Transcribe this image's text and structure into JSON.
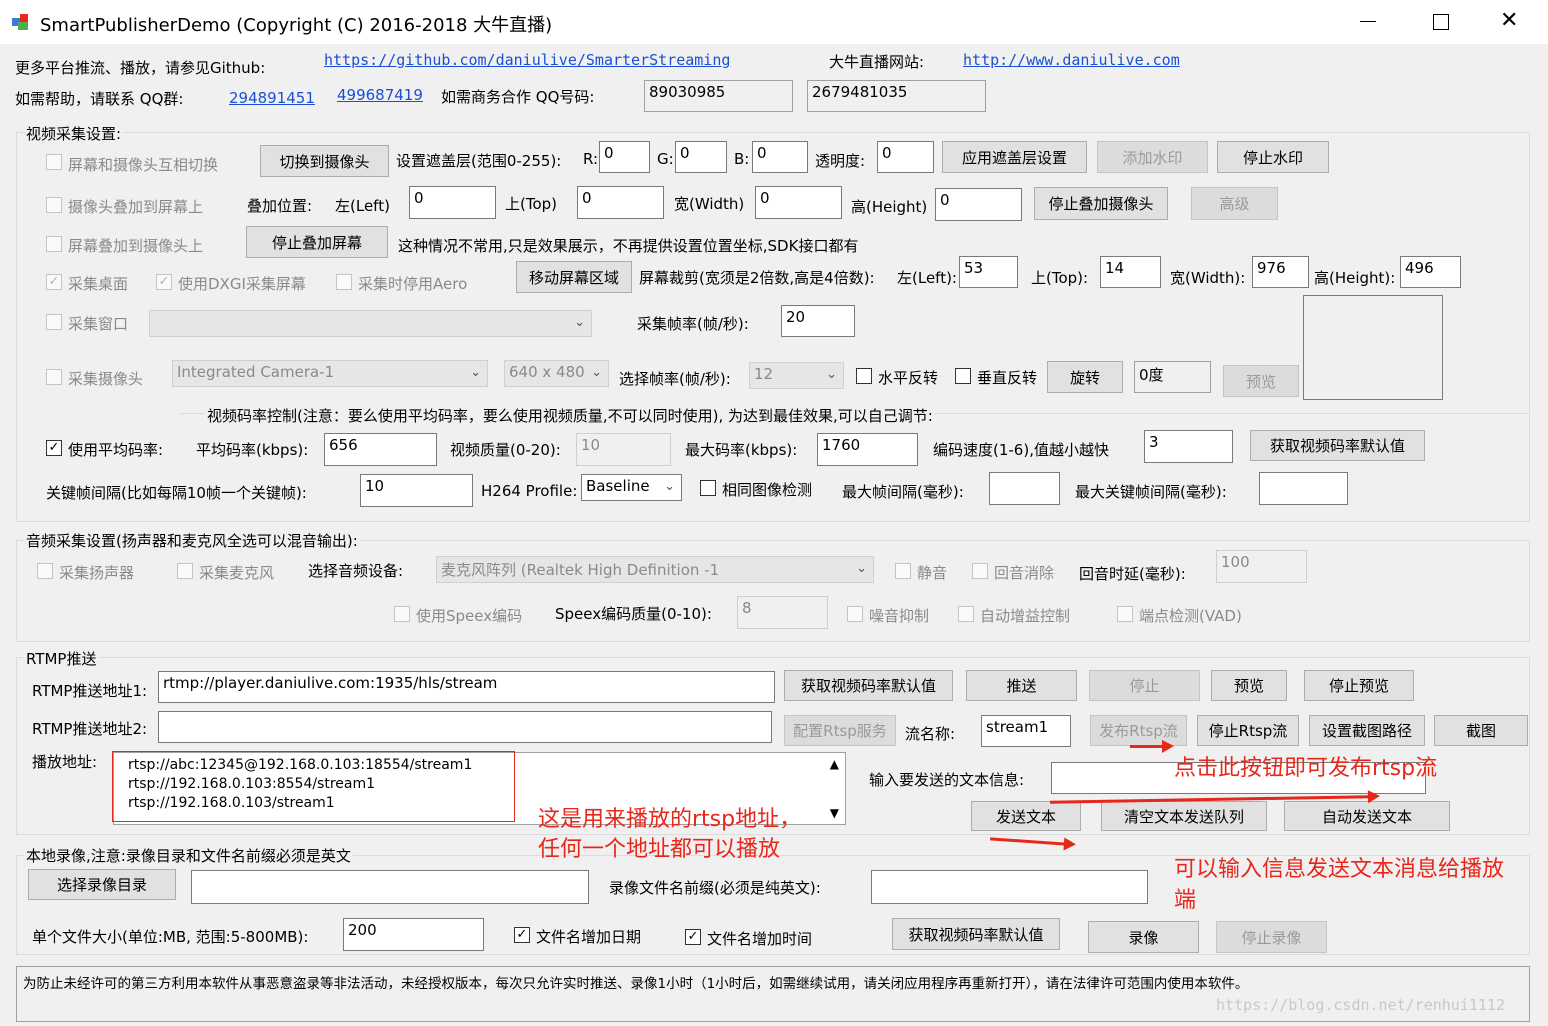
{
  "window": {
    "title": "SmartPublisherDemo  (Copyright (C) 2016-2018 大牛直播)",
    "minimize_icon": "minimize-icon",
    "maximize_icon": "maximize-icon",
    "close_icon": "close-icon"
  },
  "header": {
    "github_text": "更多平台推流、播放，请参见Github:",
    "github_link": "https://github.com/daniulive/SmarterStreaming",
    "site_label": "大牛直播网站:",
    "site_link": "http://www.daniulive.com",
    "help_text": "如需帮助，请联系 QQ群:",
    "qq_group1": "294891451",
    "qq_group2": "499687419",
    "biz_text": "如需商务合作 QQ号码:",
    "qq1": "89030985",
    "qq2": "2679481035"
  },
  "video": {
    "group_title": "视频采集设置:",
    "chk_switch": "屏幕和摄像头互相切换",
    "btn_switch_camera": "切换到摄像头",
    "overlay_label": "设置遮盖层(范围0-255):",
    "r_label": "R:",
    "r_value": "0",
    "g_label": "G:",
    "g_value": "0",
    "b_label": "B:",
    "b_value": "0",
    "alpha_label": "透明度:",
    "alpha_value": "0",
    "btn_apply_overlay": "应用遮盖层设置",
    "btn_add_watermark": "添加水印",
    "btn_stop_watermark": "停止水印",
    "chk_cam_on_screen": "摄像头叠加到屏幕上",
    "pos_label": "叠加位置:",
    "left_label": "左(Left)",
    "left_value": "0",
    "top_label": "上(Top)",
    "top_value": "0",
    "width_label": "宽(Width)",
    "width_value": "0",
    "height_label": "高(Height)",
    "height_value": "0",
    "btn_stop_cam_overlay": "停止叠加摄像头",
    "btn_advanced": "高级",
    "chk_screen_on_cam": "屏幕叠加到摄像头上",
    "btn_stop_screen_overlay": "停止叠加屏幕",
    "note_rare": "这种情况不常用,只是效果展示，不再提供设置位置坐标,SDK接口都有",
    "chk_desktop": "采集桌面",
    "chk_dxgi": "使用DXGI采集屏幕",
    "chk_aero": "采集时停用Aero",
    "btn_move_region": "移动屏幕区域",
    "crop_label": "屏幕裁剪(宽须是2倍数,高是4倍数):",
    "crop_left_label": "左(Left):",
    "crop_left": "53",
    "crop_top_label": "上(Top):",
    "crop_top": "14",
    "crop_width_label": "宽(Width):",
    "crop_width": "976",
    "crop_height_label": "高(Height):",
    "crop_height": "496",
    "chk_window": "采集窗口",
    "fps_label": "采集帧率(帧/秒):",
    "fps_value": "20",
    "chk_camera": "采集摄像头",
    "camera_device": "Integrated Camera-1",
    "camera_res": "640 x 480",
    "sel_fps_label": "选择帧率(帧/秒):",
    "sel_fps_value": "12",
    "chk_hflip": "水平反转",
    "chk_vflip": "垂直反转",
    "btn_rotate": "旋转",
    "rotate_value": "0度",
    "btn_preview": "预览"
  },
  "bitrate": {
    "title": "视频码率控制(注意：要么使用平均码率，要么使用视频质量,不可以同时使用), 为达到最佳效果,可以自己调节:",
    "chk_avg": "使用平均码率:",
    "avg_label": "平均码率(kbps):",
    "avg_value": "656",
    "quality_label": "视频质量(0-20):",
    "quality_value": "10",
    "max_label": "最大码率(kbps):",
    "max_value": "1760",
    "speed_label": "编码速度(1-6),值越小越快",
    "speed_value": "3",
    "btn_default": "获取视频码率默认值",
    "gop_label": "关键帧间隔(比如每隔10帧一个关键帧):",
    "gop_value": "10",
    "profile_label": "H264 Profile:",
    "profile_value": "Baseline",
    "chk_same_img": "相同图像检测",
    "max_frame_gap_label": "最大帧间隔(毫秒):",
    "max_key_gap_label": "最大关键帧间隔(毫秒):"
  },
  "audio": {
    "group_title": "音频采集设置(扬声器和麦克风全选可以混音输出):",
    "chk_speaker": "采集扬声器",
    "chk_mic": "采集麦克风",
    "device_label": "选择音频设备:",
    "device_value": "麦克风阵列 (Realtek High Definition -1",
    "chk_mute": "静音",
    "chk_echo": "回音消除",
    "echo_delay_label": "回音时延(毫秒):",
    "echo_delay_value": "100",
    "chk_speex": "使用Speex编码",
    "speex_quality_label": "Speex编码质量(0-10):",
    "speex_quality_value": "8",
    "chk_noise": "噪音抑制",
    "chk_agc": "自动增益控制",
    "chk_vad": "端点检测(VAD)"
  },
  "rtmp": {
    "group_title": "RTMP推送",
    "url1_label": "RTMP推送地址1:",
    "url1_value": "rtmp://player.daniulive.com:1935/hls/stream",
    "btn_get_default": "获取视频码率默认值",
    "btn_push": "推送",
    "btn_stop": "停止",
    "btn_preview": "预览",
    "btn_stop_preview": "停止预览",
    "url2_label": "RTMP推送地址2:",
    "btn_rtsp_config": "配置Rtsp服务",
    "stream_name_label": "流名称:",
    "stream_name_value": "stream1",
    "btn_publish_rtsp": "发布Rtsp流",
    "btn_stop_rtsp": "停止Rtsp流",
    "btn_snapshot_path": "设置截图路径",
    "btn_snapshot": "截图",
    "play_label": "播放地址:",
    "play_urls": [
      "rtsp://abc:12345@192.168.0.103:18554/stream1",
      "rtsp://192.168.0.103:8554/stream1",
      "rtsp://192.168.0.103/stream1"
    ],
    "text_label": "输入要发送的文本信息:",
    "btn_send_text": "发送文本",
    "btn_clear_queue": "清空文本发送队列",
    "btn_auto_send": "自动发送文本"
  },
  "record": {
    "group_title": "本地录像,注意:录像目录和文件名前缀必须是英文",
    "btn_select_dir": "选择录像目录",
    "prefix_label": "录像文件名前缀(必须是纯英文):",
    "size_label": "单个文件大小(单位:MB, 范围:5-800MB):",
    "size_value": "200",
    "chk_date": "文件名增加日期",
    "chk_time": "文件名增加时间",
    "btn_get_default": "获取视频码率默认值",
    "btn_record": "录像",
    "btn_stop_record": "停止录像"
  },
  "footer": {
    "notice": "为防止未经许可的第三方利用本软件从事恶意盗录等非法活动，未经授权版本，每次只允许实时推送、录像1小时（1小时后，如需继续试用，请关闭应用程序再重新打开），请在法律许可范围内使用本软件。",
    "watermark": "https://blog.csdn.net/renhui1112"
  },
  "annotations": {
    "publish_hint": "点击此按钮即可发布rtsp流",
    "play_hint_1": "这是用来播放的rtsp地址，",
    "play_hint_2": "任何一个地址都可以播放",
    "text_hint_1": "可以输入信息发送文本消息给播放",
    "text_hint_2": "端"
  },
  "colors": {
    "annotation": "#e8271b",
    "link": "#1a4fd6",
    "background": "#f0f0f0"
  }
}
